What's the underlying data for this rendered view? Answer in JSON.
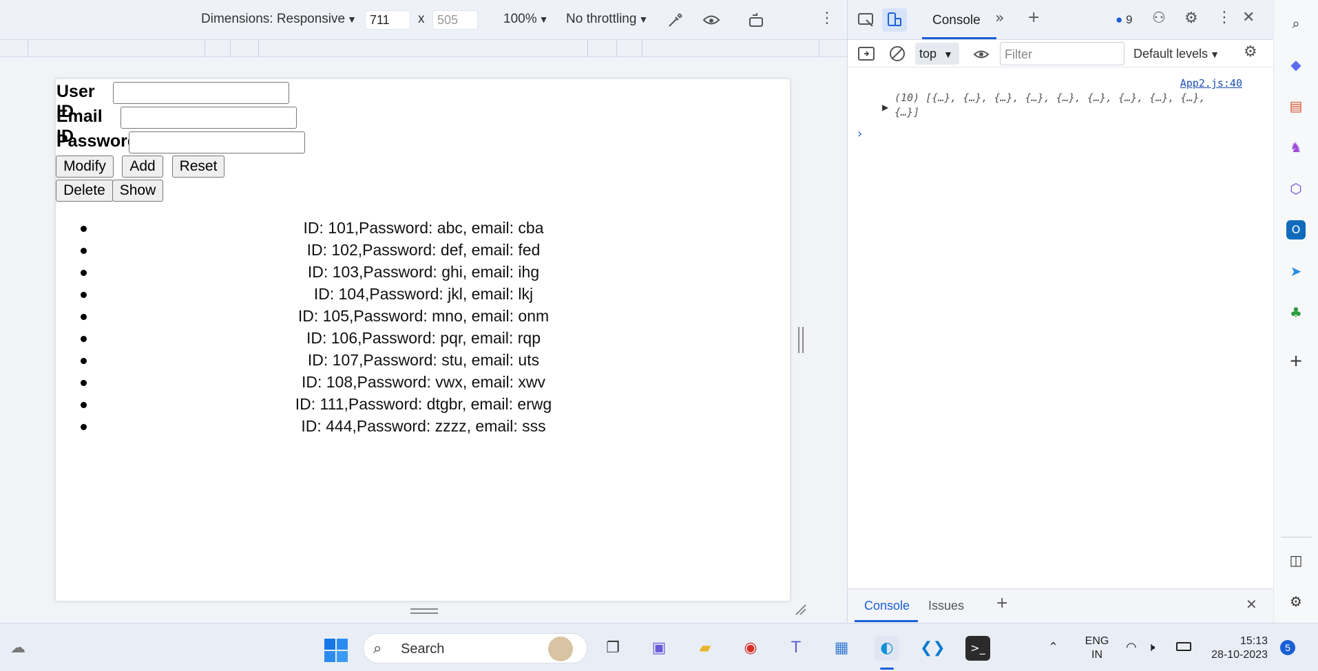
{
  "device_toolbar": {
    "dimensions_label": "Dimensions: Responsive",
    "width_value": "711",
    "height_value": "505",
    "dimension_separator": "x",
    "zoom": "100%",
    "throttling": "No throttling"
  },
  "app": {
    "form": {
      "user_id_label": "User ID",
      "email_id_label": "Email ID",
      "password_label": "Password",
      "user_id_value": "",
      "email_id_value": "",
      "password_value": ""
    },
    "buttons": {
      "modify": "Modify",
      "add": "Add",
      "reset": "Reset",
      "delete": "Delete",
      "show": "Show"
    },
    "users": [
      "ID: 101,Password: abc, email: cba",
      "ID: 102,Password: def, email: fed",
      "ID: 103,Password: ghi, email: ihg",
      "ID: 104,Password: jkl, email: lkj",
      "ID: 105,Password: mno, email: onm",
      "ID: 106,Password: pqr, email: rqp",
      "ID: 107,Password: stu, email: uts",
      "ID: 108,Password: vwx, email: xwv",
      "ID: 111,Password: dtgbr, email: erwg",
      "ID: 444,Password: zzzz, email: sss"
    ]
  },
  "devtools": {
    "tabs": {
      "console": "Console"
    },
    "issues_count": "9",
    "console_toolbar": {
      "context": "top",
      "filter_placeholder": "Filter",
      "levels": "Default levels"
    },
    "console": {
      "source": "App2.js:40",
      "log_line_1": "(10) [{…}, {…}, {…}, {…}, {…}, {…}, {…}, {…}, {…},",
      "log_line_2": "{…}]"
    },
    "drawer_tabs": {
      "console": "Console",
      "issues": "Issues"
    }
  },
  "taskbar": {
    "search_placeholder": "Search",
    "language_line1": "ENG",
    "language_line2": "IN",
    "time": "15:13",
    "date": "28-10-2023",
    "notification_count": "5"
  },
  "colors": {
    "accent": "#1a5fd6",
    "toolbar_bg": "#eef1f8",
    "taskbar_bg": "#e9eef6"
  }
}
